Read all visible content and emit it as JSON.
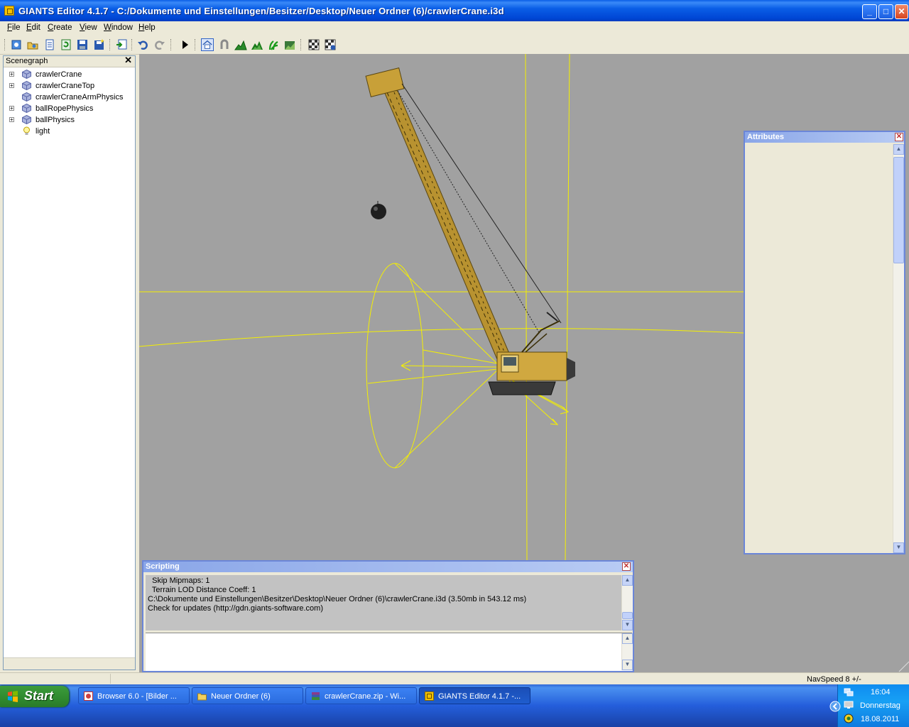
{
  "window": {
    "title": "GIANTS Editor 4.1.7 - C:/Dokumente und Einstellungen/Besitzer/Desktop/Neuer Ordner (6)/crawlerCrane.i3d",
    "controls": {
      "minimize": "_",
      "maximize": "□",
      "close": "✕"
    }
  },
  "menu": [
    "File",
    "Edit",
    "Create",
    "View",
    "Window",
    "Help"
  ],
  "toolbar": {
    "icons": [
      "new-scene-icon",
      "open-icon",
      "list-icon",
      "refresh-icon",
      "save-icon",
      "save-all-icon",
      "import-icon",
      "undo-icon",
      "redo-icon",
      "play-icon",
      "home-icon",
      "magnet-icon",
      "terrain-icon",
      "grass-icon",
      "foliage-icon",
      "texture-icon",
      "checker-icon",
      "checker-settings-icon"
    ]
  },
  "scenegraph": {
    "title": "Scenegraph",
    "close": "✕",
    "items": [
      {
        "label": "crawlerCrane",
        "expandable": true,
        "icon": "cube-icon"
      },
      {
        "label": "crawlerCraneTop",
        "expandable": true,
        "icon": "cube-icon"
      },
      {
        "label": "crawlerCraneArmPhysics",
        "expandable": false,
        "icon": "cube-icon"
      },
      {
        "label": "ballRopePhysics",
        "expandable": true,
        "icon": "cube-icon"
      },
      {
        "label": "ballPhysics",
        "expandable": true,
        "icon": "cube-icon"
      },
      {
        "label": "light",
        "expandable": false,
        "icon": "light-bulb-icon"
      }
    ]
  },
  "attributes": {
    "title": "Attributes",
    "close": "✕"
  },
  "scripting": {
    "title": "Scripting",
    "close": "✕",
    "log": [
      "  Skip Mipmaps: 1",
      "  Terrain LOD Distance Coeff: 1",
      "C:\\Dokumente und Einstellungen\\Besitzer\\Desktop\\Neuer Ordner (6)\\crawlerCrane.i3d (3.50mb in 543.12 ms)",
      "Check for updates (http://gdn.giants-software.com)"
    ],
    "input_value": ""
  },
  "status": {
    "navspeed": "NavSpeed 8 +/-"
  },
  "taskbar": {
    "start": "Start",
    "tasks": [
      {
        "label": "Browser 6.0 - [Bilder ...",
        "icon": "browser-icon",
        "active": false
      },
      {
        "label": "Neuer Ordner (6)",
        "icon": "folder-icon",
        "active": false
      },
      {
        "label": "crawlerCrane.zip - Wi...",
        "icon": "winrar-icon",
        "active": false
      },
      {
        "label": "GIANTS Editor 4.1.7 -...",
        "icon": "giants-icon",
        "active": true
      }
    ],
    "clock": {
      "time": "16:04",
      "day": "Donnerstag",
      "date": "18.08.2011"
    }
  },
  "colors": {
    "viewport_bg": "#a1a1a1",
    "gizmo": "#f5f000",
    "crane_body": "#c8a038",
    "titlebar": "#0a5ee6"
  }
}
